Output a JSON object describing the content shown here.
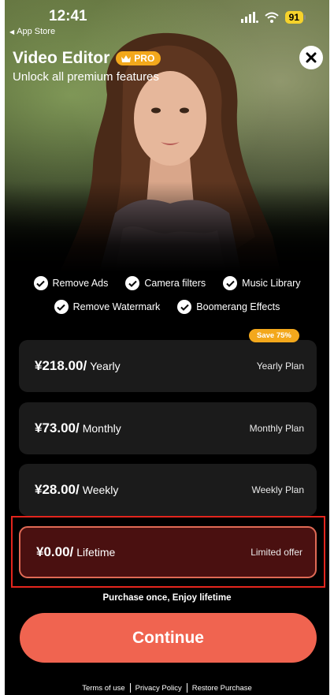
{
  "status_bar": {
    "time": "12:41",
    "back_label": "App Store",
    "battery": "91"
  },
  "header": {
    "title": "Video Editor",
    "badge": "PRO",
    "subtitle": "Unlock all premium features"
  },
  "features": [
    {
      "label": "Remove Ads"
    },
    {
      "label": "Camera filters"
    },
    {
      "label": "Music Library"
    },
    {
      "label": "Remove Watermark"
    },
    {
      "label": "Boomerang Effects"
    }
  ],
  "plans": [
    {
      "price": "¥218.00/",
      "period": "Yearly",
      "name": "Yearly Plan",
      "badge": "Save 75%"
    },
    {
      "price": "¥73.00/",
      "period": "Monthly",
      "name": "Monthly Plan"
    },
    {
      "price": "¥28.00/",
      "period": "Weekly",
      "name": "Weekly Plan"
    },
    {
      "price": "¥0.00/",
      "period": "Lifetime",
      "name": "Limited offer",
      "selected": true
    }
  ],
  "purchase_note": "Purchase once,  Enjoy lifetime",
  "continue_label": "Continue",
  "footer": {
    "terms": "Terms of use",
    "privacy": "Privacy Policy",
    "restore": "Restore Purchase"
  },
  "colors": {
    "accent": "#f06450",
    "badge": "#f3a81c",
    "selected_plan_bg": "#4a1010",
    "highlight": "#e3251d"
  },
  "icons": [
    "back-chevron-icon",
    "signal-icon",
    "wifi-icon",
    "battery-icon",
    "crown-icon",
    "close-icon",
    "check-icon"
  ]
}
